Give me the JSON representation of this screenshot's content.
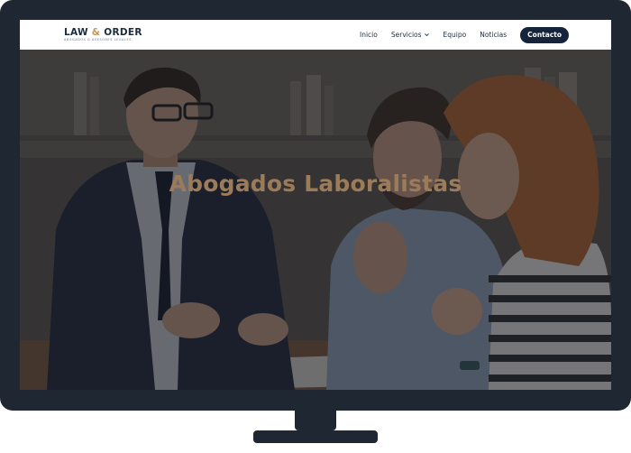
{
  "brand": {
    "name_left": "LAW",
    "name_amp": "&",
    "name_right": "ORDER",
    "tagline": "ABOGADOS & ASESORES LEGALES",
    "accent_color": "#c8955c",
    "navy_color": "#15243a"
  },
  "nav": {
    "items": [
      {
        "label": "Inicio"
      },
      {
        "label": "Servicios"
      },
      {
        "label": "Equipo"
      },
      {
        "label": "Noticias"
      }
    ],
    "cta_label": "Contacto"
  },
  "hero": {
    "title": "Abogados Laboralistas"
  },
  "icons": {
    "servicios_dropdown": "chevron-down-icon"
  }
}
